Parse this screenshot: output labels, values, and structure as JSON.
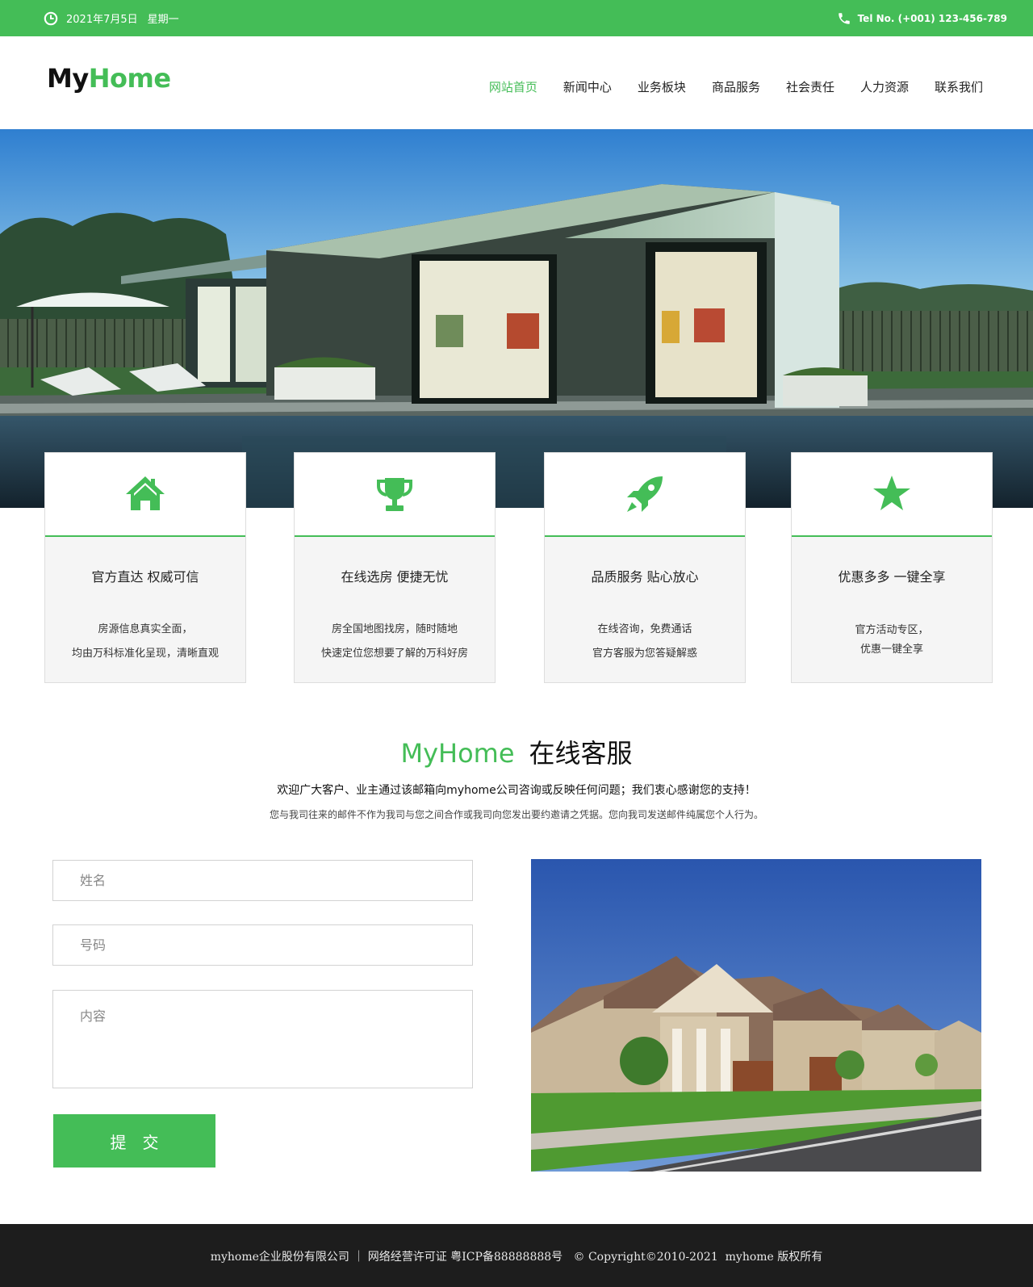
{
  "topbar": {
    "date": "2021年7月5日",
    "weekday": "星期一",
    "tel": "Tel No. (+001) 123-456-789"
  },
  "header": {
    "logo_part1": "My",
    "logo_part2": "Home",
    "nav": [
      {
        "label": "网站首页",
        "active": true
      },
      {
        "label": "新闻中心"
      },
      {
        "label": "业务板块"
      },
      {
        "label": "商品服务"
      },
      {
        "label": "社会责任"
      },
      {
        "label": "人力资源"
      },
      {
        "label": "联系我们"
      }
    ]
  },
  "features": [
    {
      "icon": "home-icon",
      "title": "官方直达  权威可信",
      "line1": "房源信息真实全面，",
      "line2": "均由万科标准化呈现，清晰直观"
    },
    {
      "icon": "trophy-icon",
      "title": "在线选房  便捷无忧",
      "line1": "房全国地图找房，随时随地",
      "line2": "快速定位您想要了解的万科好房"
    },
    {
      "icon": "rocket-icon",
      "title": "品质服务  贴心放心",
      "line1": "在线咨询，免费通话",
      "line2": "官方客服为您答疑解惑"
    },
    {
      "icon": "star-icon",
      "title": "优惠多多  一键全享",
      "line1": "官方活动专区，",
      "line2": "优惠一键全享"
    }
  ],
  "service": {
    "title_green": "MyHome",
    "title_black": "在线客服",
    "subtitle": "欢迎广大客户、业主通过该邮箱向myhome公司咨询或反映任何问题；我们衷心感谢您的支持！",
    "note": "您与我司往来的邮件不作为我司与您之间合作或我司向您发出要约邀请之凭据。您向我司发送邮件纯属您个人行为。"
  },
  "form": {
    "name_placeholder": "姓名",
    "phone_placeholder": "号码",
    "content_placeholder": "内容",
    "submit_label": "提交"
  },
  "footer": {
    "text": "myhome企业股份有限公司 ｜ 网络经营许可证 粤ICP备88888888号   © Copyright©2010-2021  myhome 版权所有"
  },
  "colors": {
    "accent": "#44bd57",
    "footer_bg": "#1d1d1d"
  }
}
